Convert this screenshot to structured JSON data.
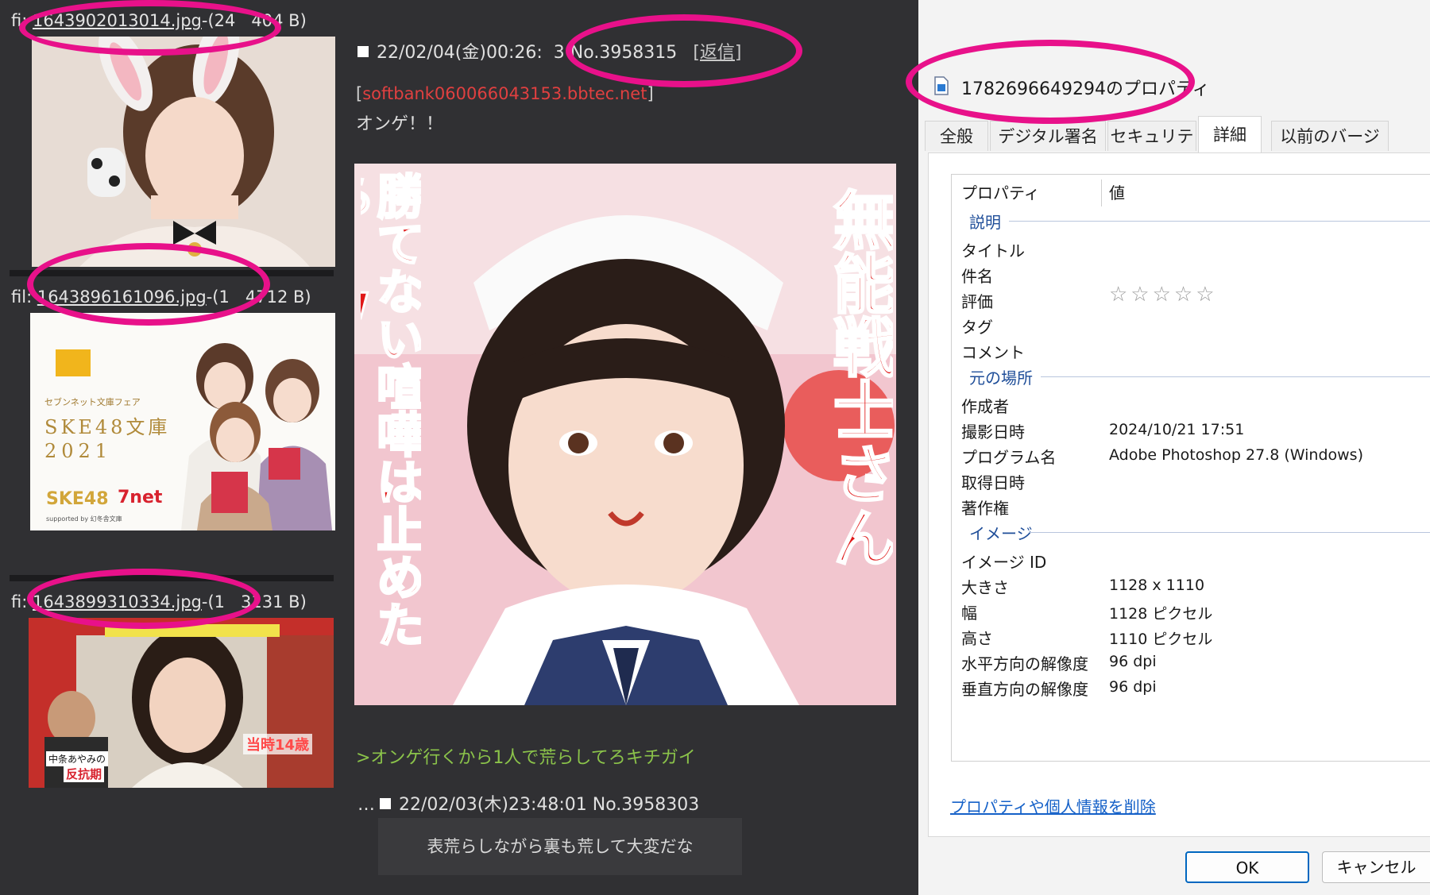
{
  "thread": {
    "files": [
      {
        "prefix": "fi",
        "name": "1643902013014.jpg",
        "suffix": "-(24",
        "size_tail": "404 B)"
      },
      {
        "prefix": "fil",
        "name": "1643896161096.jpg",
        "suffix": "-(1",
        "size_tail": "4712 B)"
      },
      {
        "prefix": "fi",
        "name": "1643899310334.jpg",
        "suffix": "-(1",
        "size_tail": "3131 B)"
      }
    ],
    "post": {
      "datetime": "22/02/04(金)00:26:",
      "datetime_tail": "3",
      "number": "No.3958315",
      "reply_label": "[返信]",
      "host": "softbank060066043153.bbtec.net",
      "body": "オンゲ！！"
    },
    "main_image": {
      "left_caption": "勝てない喧嘩は止めたら?w",
      "right_caption": "無能戦士さん"
    },
    "thumb2": {
      "line1": "セブンネット文庫フェア",
      "line2": "SKE48文庫",
      "line3": "2021",
      "brand": "SKE48",
      "partner": "7net",
      "note": "supported by 幻冬舎文庫"
    },
    "thumb3": {
      "badge": "当時14歳",
      "name_line1": "中条あやみの",
      "name_line2": "反抗期"
    },
    "quote": ">オンゲ行くから1人で荒らしてろキチガイ",
    "post2": {
      "dots": "…",
      "datetime": "22/02/03(木)23:48:01",
      "number": "No.3958303",
      "body": "表荒らしながら裏も荒して大変だな"
    }
  },
  "dialog": {
    "title": "1782696649294のプロパティ",
    "tabs": [
      "全般",
      "デジタル署名",
      "セキュリティ",
      "詳細",
      "以前のバージョン"
    ],
    "active_tab": "詳細",
    "columns": {
      "name": "プロパティ",
      "value": "値"
    },
    "groups": {
      "description": "説明",
      "origin": "元の場所",
      "image": "イメージ"
    },
    "props": {
      "title": "タイトル",
      "subject": "件名",
      "rating": "評価",
      "rating_value": "☆☆☆☆☆",
      "tags": "タグ",
      "comments": "コメント",
      "authors": "作成者",
      "date_taken": "撮影日時",
      "date_taken_value": "2024/10/21 17:51",
      "program": "プログラム名",
      "program_value": "Adobe Photoshop 27.8 (Windows)",
      "date_acquired": "取得日時",
      "copyright": "著作権",
      "image_id": "イメージ ID",
      "dimensions": "大きさ",
      "dimensions_value": "1128 x 1110",
      "width": "幅",
      "width_value": "1128 ピクセル",
      "height": "高さ",
      "height_value": "1110 ピクセル",
      "hres": "水平方向の解像度",
      "hres_value": "96 dpi",
      "vres": "垂直方向の解像度",
      "vres_value": "96 dpi"
    },
    "remove_link": "プロパティや個人情報を削除",
    "ok_label": "OK",
    "cancel_label": "キャンセル"
  },
  "colors": {
    "highlight_ring": "#e8118a",
    "host_red": "#e04040",
    "quote_green": "#8bc34a",
    "link_blue": "#1561c8"
  }
}
